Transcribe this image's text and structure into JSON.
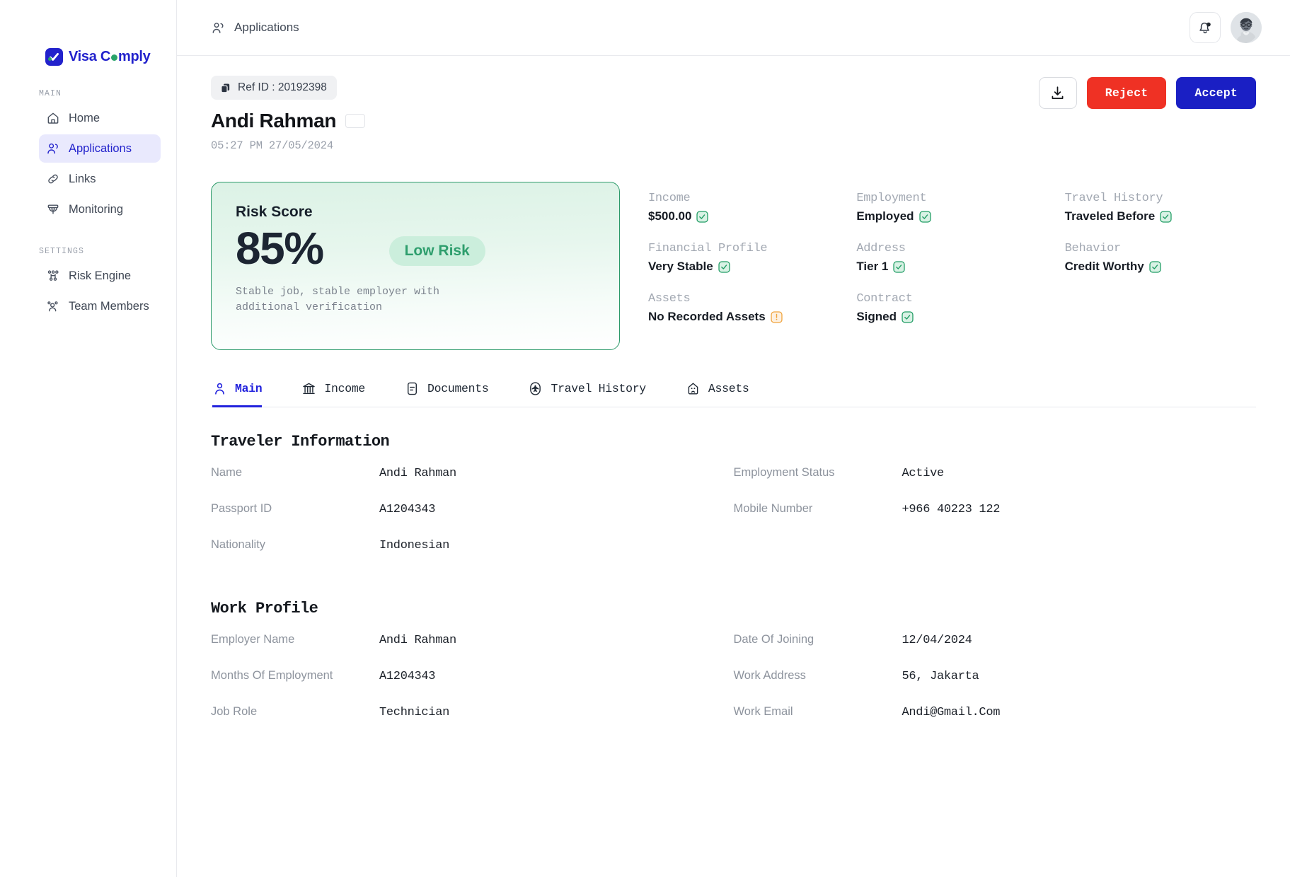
{
  "brand": {
    "name_prefix": "Visa C",
    "name_suffix": "mply"
  },
  "sidebar": {
    "sections": [
      {
        "caption": "MAIN",
        "items": [
          {
            "label": "Home",
            "icon": "home-icon",
            "active": false
          },
          {
            "label": "Applications",
            "icon": "users-icon",
            "active": true
          },
          {
            "label": "Links",
            "icon": "link-icon",
            "active": false
          },
          {
            "label": "Monitoring",
            "icon": "cctv-icon",
            "active": false
          }
        ]
      },
      {
        "caption": "SETTINGS",
        "items": [
          {
            "label": "Risk Engine",
            "icon": "nodes-icon",
            "active": false
          },
          {
            "label": "Team Members",
            "icon": "team-icon",
            "active": false
          }
        ]
      }
    ]
  },
  "topbar": {
    "breadcrumb": "Applications",
    "bell": "bell-icon",
    "avatar": "avatar"
  },
  "header": {
    "ref_label": "Ref ID : 20192398",
    "name": "Andi Rahman",
    "flag": "indonesia-flag",
    "timestamp": "05:27 PM 27/05/2024",
    "download_label": "download-icon",
    "reject_label": "Reject",
    "accept_label": "Accept",
    "reject_color": "#ef3124",
    "accept_color": "#1a1fc4"
  },
  "risk": {
    "title": "Risk Score",
    "score": "85%",
    "badge": "Low Risk",
    "badge_color": "#2e9e6d",
    "note": "Stable job, stable employer with additional verification"
  },
  "attributes": [
    {
      "label": "Income",
      "value": "$500.00",
      "status": "ok"
    },
    {
      "label": "Employment",
      "value": "Employed",
      "status": "ok"
    },
    {
      "label": "Travel History",
      "value": "Traveled Before",
      "status": "ok"
    },
    {
      "label": "Financial Profile",
      "value": "Very Stable",
      "status": "ok"
    },
    {
      "label": "Address",
      "value": "Tier 1",
      "status": "ok"
    },
    {
      "label": "Behavior",
      "value": "Credit Worthy",
      "status": "ok"
    },
    {
      "label": "Assets",
      "value": "No Recorded Assets",
      "status": "warn"
    },
    {
      "label": "Contract",
      "value": "Signed",
      "status": "ok"
    },
    {
      "label": "",
      "value": "",
      "status": "none"
    }
  ],
  "tabs": [
    {
      "label": "Main",
      "icon": "person-icon",
      "active": true
    },
    {
      "label": "Income",
      "icon": "bank-icon",
      "active": false
    },
    {
      "label": "Documents",
      "icon": "document-icon",
      "active": false
    },
    {
      "label": "Travel History",
      "icon": "airplane-icon",
      "active": false
    },
    {
      "label": "Assets",
      "icon": "house-icon",
      "active": false
    }
  ],
  "sections": [
    {
      "title": "Traveler Information",
      "left": [
        {
          "key": "Name",
          "value": "Andi Rahman"
        },
        {
          "key": "Passport ID",
          "value": "A1204343"
        },
        {
          "key": "Nationality",
          "value": "Indonesian"
        }
      ],
      "right": [
        {
          "key": "Employment Status",
          "value": "Active"
        },
        {
          "key": "Mobile Number",
          "value": "+966 40223 122"
        }
      ]
    },
    {
      "title": "Work Profile",
      "left": [
        {
          "key": "Employer Name",
          "value": "Andi Rahman"
        },
        {
          "key": "Months Of Employment",
          "value": "A1204343"
        },
        {
          "key": "Job Role",
          "value": "Technician"
        }
      ],
      "right": [
        {
          "key": "Date Of Joining",
          "value": "12/04/2024"
        },
        {
          "key": "Work Address",
          "value": "56, Jakarta"
        },
        {
          "key": "Work Email",
          "value": "Andi@Gmail.Com"
        }
      ]
    }
  ]
}
